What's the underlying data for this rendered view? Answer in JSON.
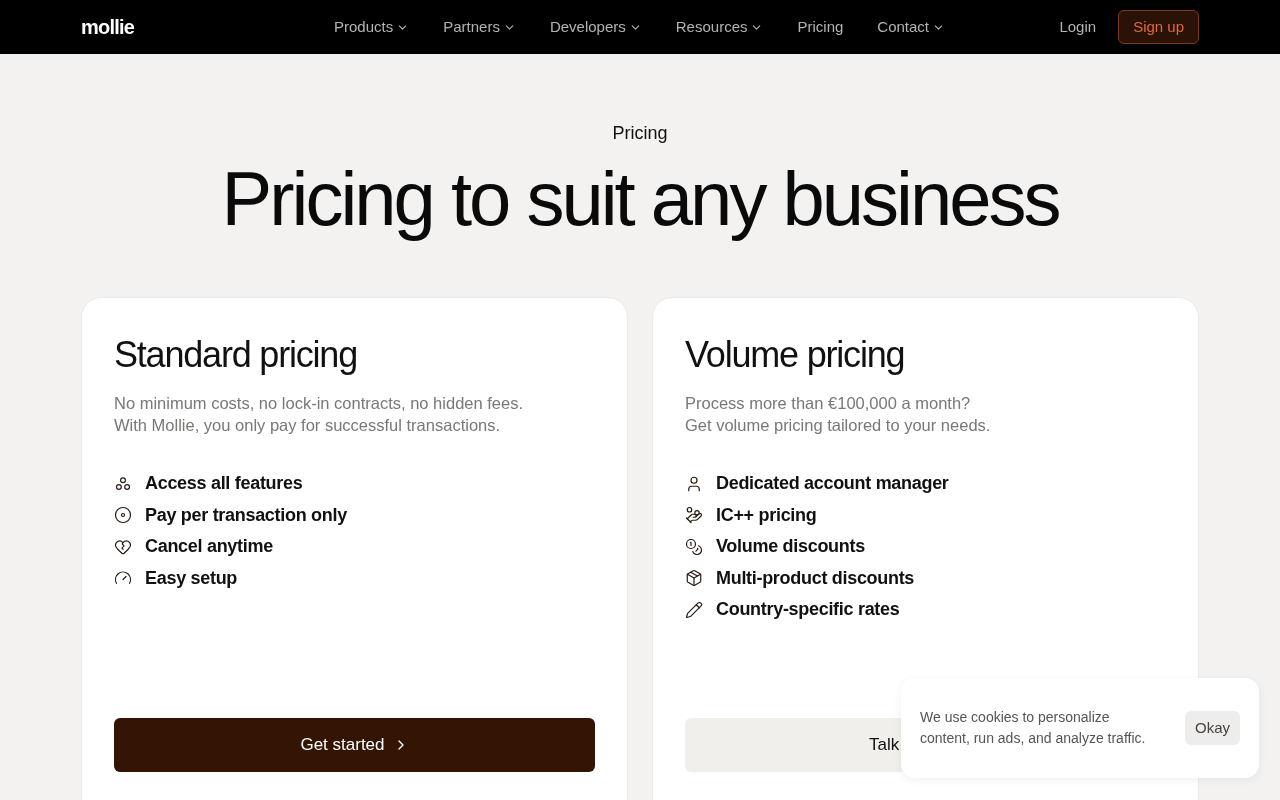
{
  "nav": {
    "logo": "mollie",
    "items": [
      {
        "label": "Products",
        "has_menu": true
      },
      {
        "label": "Partners",
        "has_menu": true
      },
      {
        "label": "Developers",
        "has_menu": true
      },
      {
        "label": "Resources",
        "has_menu": true
      },
      {
        "label": "Pricing",
        "has_menu": false
      },
      {
        "label": "Contact",
        "has_menu": true
      }
    ],
    "login": "Login",
    "signup": "Sign up"
  },
  "hero": {
    "eyebrow": "Pricing",
    "title": "Pricing to suit any business"
  },
  "cards": [
    {
      "title": "Standard pricing",
      "description": [
        "No minimum costs, no lock-in contracts, no hidden fees.",
        "With Mollie, you only pay for successful transactions."
      ],
      "features": [
        {
          "kind": "circles",
          "label": "Access all features"
        },
        {
          "kind": "coin",
          "label": "Pay per transaction only"
        },
        {
          "kind": "heart",
          "label": "Cancel anytime"
        },
        {
          "kind": "gauge",
          "label": "Easy setup"
        }
      ],
      "button": {
        "label": "Get started",
        "kind": "primary"
      }
    },
    {
      "title": "Volume pricing",
      "description": [
        "Process more than €100,000 a month?",
        "Get volume pricing tailored to your needs."
      ],
      "features": [
        {
          "kind": "user",
          "label": "Dedicated account manager"
        },
        {
          "kind": "hand",
          "label": "IC++ pricing"
        },
        {
          "kind": "coins",
          "label": "Volume discounts"
        },
        {
          "kind": "package",
          "label": "Multi-product discounts"
        },
        {
          "kind": "pencil",
          "label": "Country-specific rates"
        }
      ],
      "button": {
        "label": "Talk",
        "kind": "secondary"
      }
    }
  ],
  "cookie": {
    "text": "We use cookies to personalize content, run ads, and analyze traffic.",
    "button": "Okay"
  }
}
